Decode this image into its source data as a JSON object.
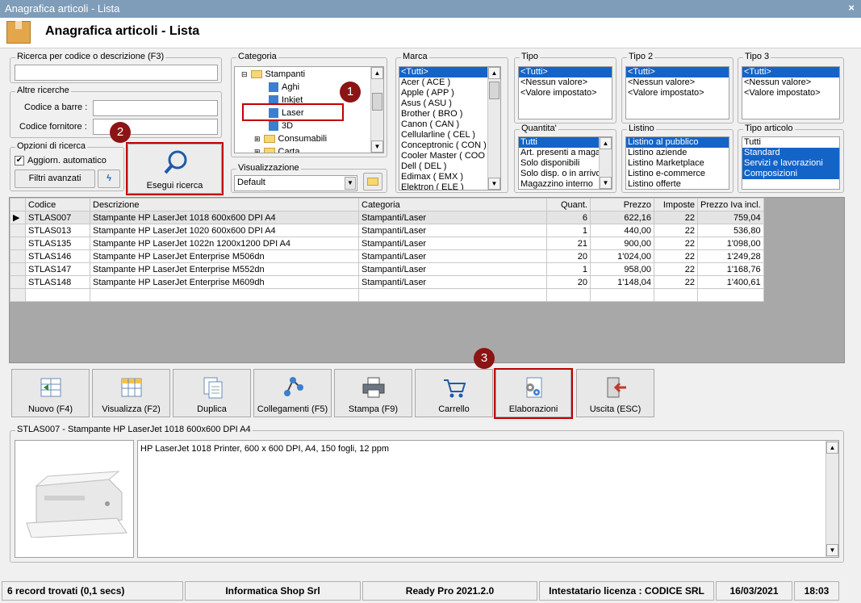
{
  "window": {
    "title": "Anagrafica articoli  - Lista",
    "close": "×"
  },
  "header": {
    "title": "Anagrafica articoli  - Lista"
  },
  "search": {
    "group_label": "Ricerca per codice o descrizione (F3)",
    "value": "",
    "other_label": "Altre ricerche",
    "barcode_label": "Codice a barre :",
    "supplier_label": "Codice fornitore :",
    "options_label": "Opzioni di ricerca",
    "auto_update_label": "Aggiorn. automatico",
    "advanced_filters": "Filtri avanzati",
    "search_button": "Esegui ricerca"
  },
  "categoria": {
    "label": "Categoria",
    "items": [
      "Stampanti",
      "Aghi",
      "Inkjet",
      "Laser",
      "3D",
      "Consumabili",
      "Carta"
    ]
  },
  "visualizzazione": {
    "label": "Visualizzazione",
    "value": "Default"
  },
  "marca": {
    "label": "Marca",
    "items": [
      "<Tutti>",
      "Acer ( ACE )",
      "Apple ( APP )",
      "Asus ( ASU )",
      "Brother ( BRO )",
      "Canon ( CAN )",
      "Cellularline ( CEL )",
      "Conceptronic ( CON )",
      "Cooler Master ( COO )",
      "Dell ( DEL )",
      "Edimax ( EMX )",
      "Elektron ( ELE )"
    ]
  },
  "tipo": {
    "label": "Tipo",
    "items": [
      "<Tutti>",
      "<Nessun valore>",
      "<Valore impostato>"
    ]
  },
  "tipo2": {
    "label": "Tipo 2",
    "items": [
      "<Tutti>",
      "<Nessun valore>",
      "<Valore impostato>"
    ]
  },
  "tipo3": {
    "label": "Tipo 3",
    "items": [
      "<Tutti>",
      "<Nessun valore>",
      "<Valore impostato>"
    ]
  },
  "quantita": {
    "label": "Quantita'",
    "items": [
      "Tutti",
      "Art. presenti a maga",
      "Solo disponibili",
      "Solo disp. o in arrivo",
      "Magazzino interno"
    ]
  },
  "listino": {
    "label": "Listino",
    "items": [
      "Listino al pubblico",
      "Listino aziende",
      "Listino Marketplace",
      "Listino e-commerce",
      "Listino offerte"
    ]
  },
  "tipo_articolo": {
    "label": "Tipo articolo",
    "items": [
      "Tutti",
      "Standard",
      "Servizi e lavorazioni",
      "Composizioni"
    ]
  },
  "table": {
    "headers": [
      "Codice",
      "Descrizione",
      "Categoria",
      "Quant.",
      "Prezzo",
      "Imposte",
      "Prezzo Iva incl."
    ],
    "rows": [
      [
        "STLAS007",
        "Stampante HP LaserJet 1018 600x600 DPI A4",
        "Stampanti/Laser",
        "6",
        "622,16",
        "22",
        "759,04"
      ],
      [
        "STLAS013",
        "Stampante HP LaserJet 1020 600x600 DPI A4",
        "Stampanti/Laser",
        "1",
        "440,00",
        "22",
        "536,80"
      ],
      [
        "STLAS135",
        "Stampante HP LaserJet 1022n 1200x1200 DPI A4",
        "Stampanti/Laser",
        "21",
        "900,00",
        "22",
        "1'098,00"
      ],
      [
        "STLAS146",
        "Stampante HP LaserJet Enterprise M506dn",
        "Stampanti/Laser",
        "20",
        "1'024,00",
        "22",
        "1'249,28"
      ],
      [
        "STLAS147",
        "Stampante HP LaserJet Enterprise M552dn",
        "Stampanti/Laser",
        "1",
        "958,00",
        "22",
        "1'168,76"
      ],
      [
        "STLAS148",
        "Stampante HP LaserJet Enterprise M609dh",
        "Stampanti/Laser",
        "20",
        "1'148,04",
        "22",
        "1'400,61"
      ]
    ]
  },
  "toolbar": {
    "nuovo": "Nuovo (F4)",
    "visualizza": "Visualizza (F2)",
    "duplica": "Duplica",
    "collegamenti": "Collegamenti (F5)",
    "stampa": "Stampa (F9)",
    "carrello": "Carrello",
    "elaborazioni": "Elaborazioni",
    "uscita": "Uscita (ESC)"
  },
  "detail": {
    "label": "STLAS007 - Stampante HP LaserJet 1018 600x600 DPI A4",
    "text": "HP LaserJet 1018 Printer, 600 x 600 DPI, A4, 150 fogli, 12 ppm"
  },
  "badges": [
    "1",
    "2",
    "3"
  ],
  "status": {
    "records": "6 record trovati (0,1 secs)",
    "company": "Informatica Shop Srl",
    "version": "Ready Pro 2021.2.0",
    "license": "Intestatario licenza : CODICE SRL",
    "date": "16/03/2021",
    "time": "18:03"
  },
  "colors": {
    "selection": "#1464c8",
    "highlight": "#c00000",
    "badge": "#8b1414"
  }
}
